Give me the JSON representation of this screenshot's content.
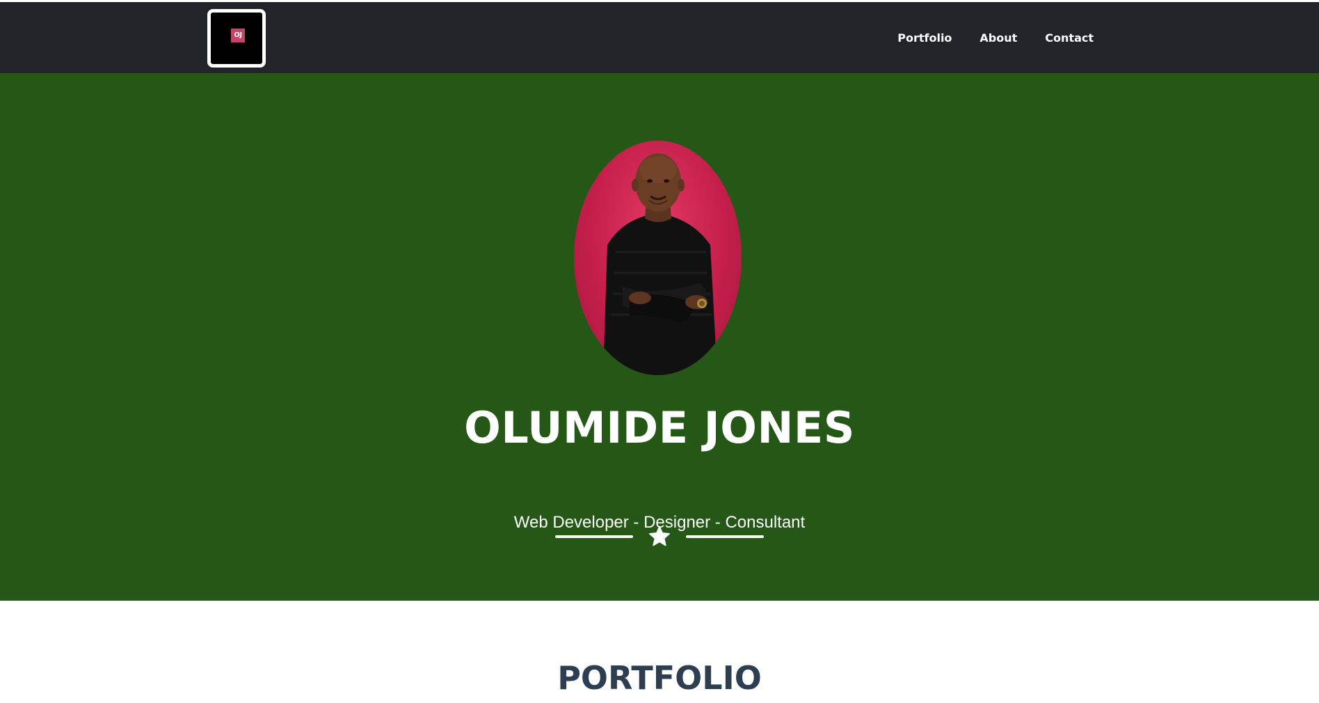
{
  "navbar": {
    "brand": {
      "logo_text": "OJ",
      "logo_color": "#c8436a"
    },
    "links": [
      {
        "label": "Portfolio"
      },
      {
        "label": "About"
      },
      {
        "label": "Contact"
      }
    ]
  },
  "masthead": {
    "background_color": "#255817",
    "avatar_icon": "profile-photo",
    "heading": "OLUMIDE JONES",
    "divider_icon": "star-icon",
    "subheading": "Web Developer - Designer - Consultant"
  },
  "portfolio": {
    "heading": "PORTFOLIO"
  },
  "colors": {
    "navbar": "#212529",
    "heading_dark": "#2c3e50"
  }
}
